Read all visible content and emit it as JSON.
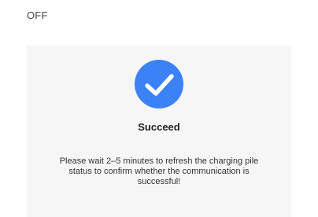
{
  "top_status": "OFF",
  "dialog": {
    "icon": "check-circle-icon",
    "title": "Succeed",
    "message": "Please wait 2–5 minutes to refresh the charging pile status to confirm whether the communication is successful!",
    "colors": {
      "icon_fill": "#3b82f6",
      "card_bg": "#f6f6f7"
    }
  }
}
